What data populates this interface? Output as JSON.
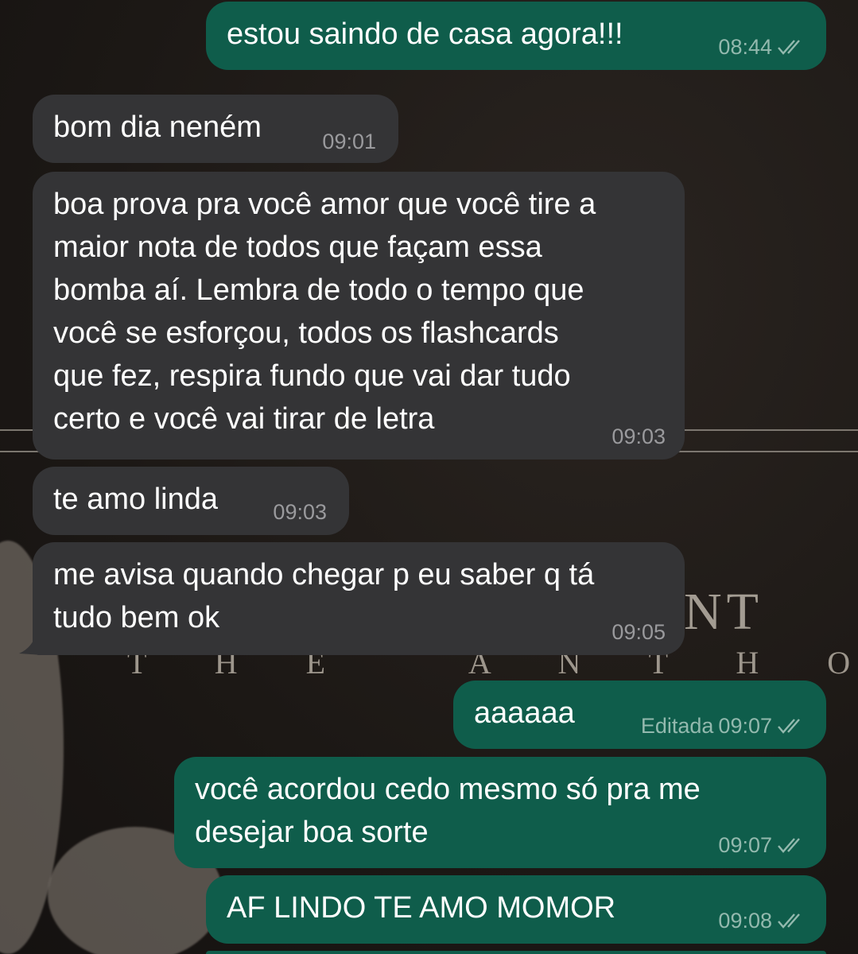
{
  "wallpaper": {
    "subtitle": "T H E   A N T H O L O G Y",
    "big_letters": "NT"
  },
  "messages": [
    {
      "id": "m1",
      "direction": "out",
      "text": "estou saindo de casa agora!!!",
      "time": "08:44",
      "status": "read",
      "edited_label": ""
    },
    {
      "id": "m2",
      "direction": "in",
      "text": "bom dia neném",
      "time": "09:01"
    },
    {
      "id": "m3",
      "direction": "in",
      "text": "boa prova pra você amor que você tire a\nmaior nota de todos que façam essa\nbomba aí. Lembra de todo o tempo que\nvocê se esforçou, todos os flashcards\nque fez, respira fundo que vai dar tudo\ncerto e você vai tirar de letra",
      "time": "09:03"
    },
    {
      "id": "m4",
      "direction": "in",
      "text": "te amo linda",
      "time": "09:03"
    },
    {
      "id": "m5",
      "direction": "in",
      "text": "me avisa quando chegar p eu saber q tá\ntudo bem ok",
      "time": "09:05"
    },
    {
      "id": "m6",
      "direction": "out",
      "text": "aaaaaa",
      "time": "09:07",
      "status": "read",
      "edited_label": "Editada"
    },
    {
      "id": "m7",
      "direction": "out",
      "text": "você acordou cedo mesmo só pra me\ndesejar boa sorte",
      "time": "09:07",
      "status": "read",
      "edited_label": ""
    },
    {
      "id": "m8",
      "direction": "out",
      "text": "AF LINDO TE AMO MOMOR",
      "time": "09:08",
      "status": "read",
      "edited_label": ""
    }
  ],
  "colors": {
    "incoming": "#343436",
    "outgoing": "#0f5d4b",
    "read_tick": "#93b9ae"
  }
}
